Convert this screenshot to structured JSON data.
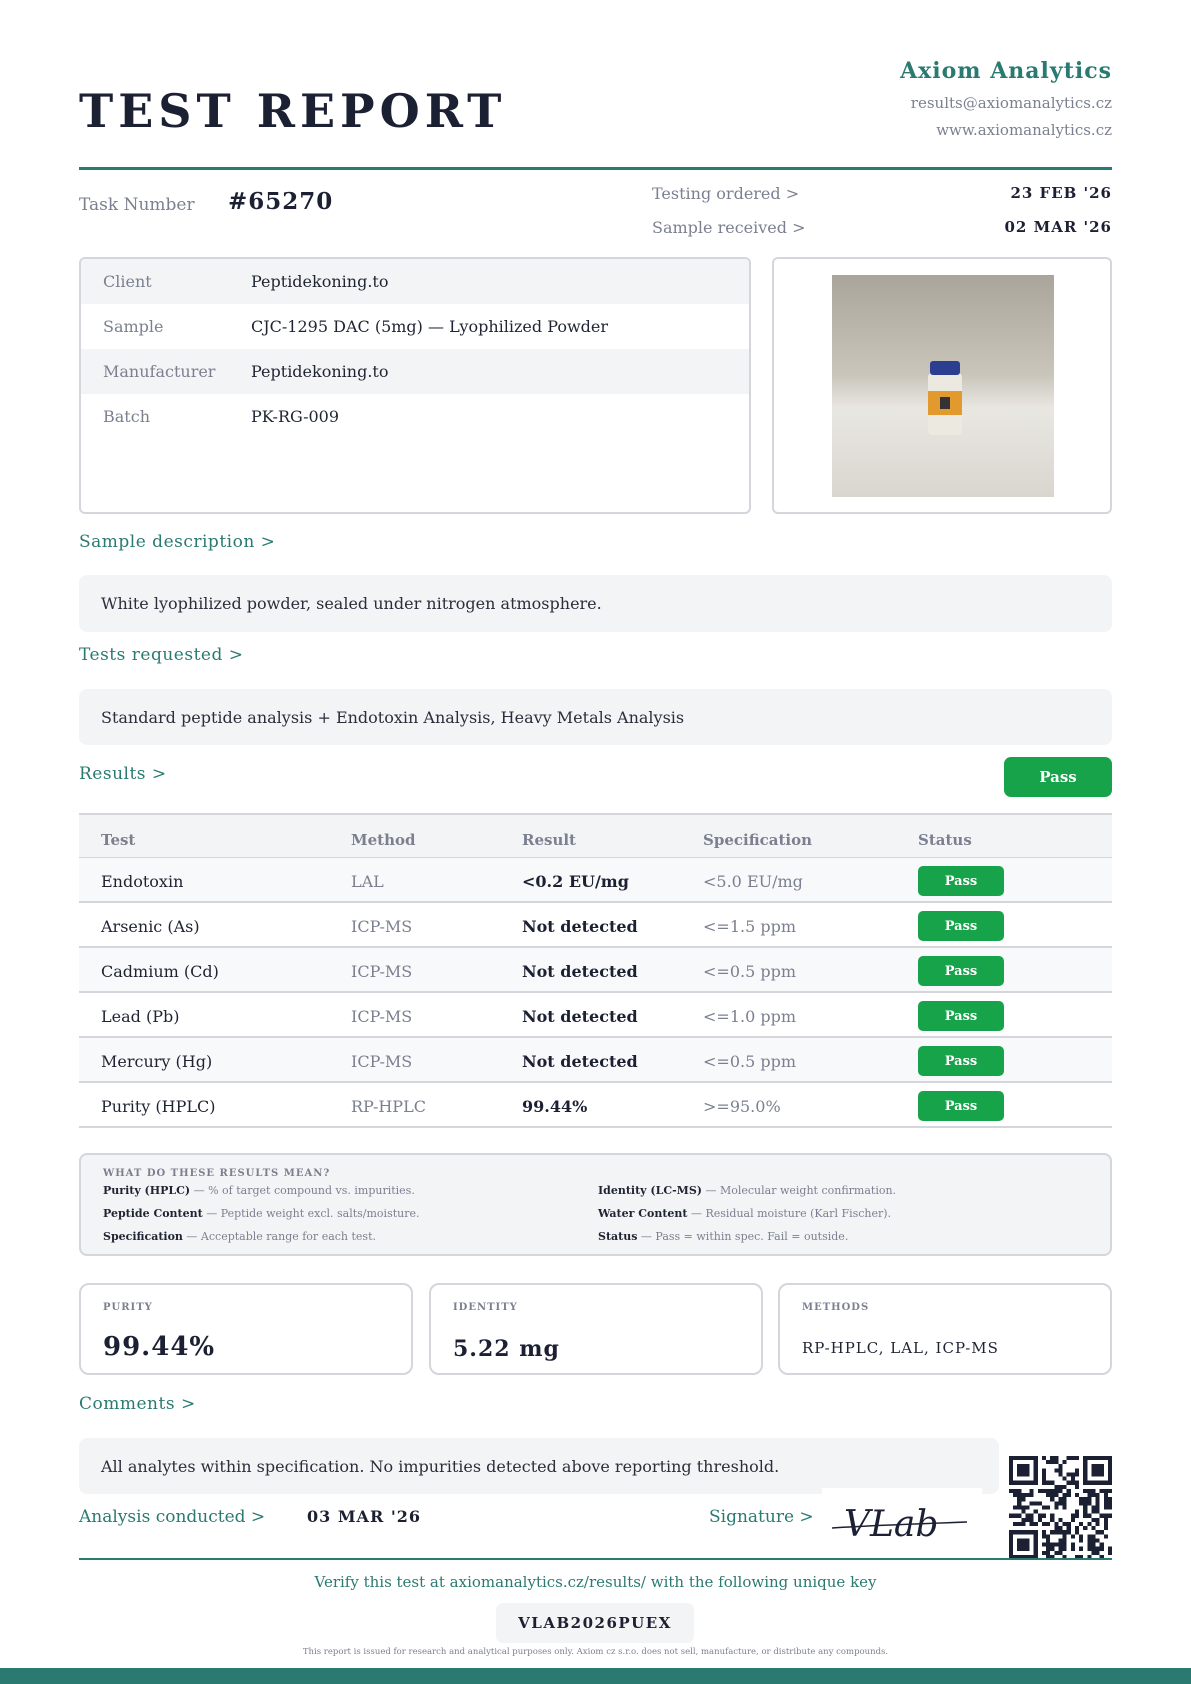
{
  "header": {
    "title": "TEST REPORT",
    "brand": "Axiom Analytics",
    "email": "results@axiomanalytics.cz",
    "website": "www.axiomanalytics.cz"
  },
  "meta": {
    "task_label": "Task Number",
    "task_number": "#65270",
    "ordered_label": "Testing ordered >",
    "ordered_value": "23 FEB '26",
    "received_label": "Sample received >",
    "received_value": "02 MAR '26"
  },
  "info": [
    {
      "label": "Client",
      "value": "Peptidekoning.to"
    },
    {
      "label": "Sample",
      "value": " CJC-1295 DAC (5mg) — Lyophilized Powder"
    },
    {
      "label": "Manufacturer",
      "value": "Peptidekoning.to"
    },
    {
      "label": "Batch",
      "value": "PK-RG-009"
    }
  ],
  "sample_description": {
    "heading": "Sample description >",
    "text": "White lyophilized powder, sealed under nitrogen atmosphere."
  },
  "tests_requested": {
    "heading": "Tests requested >",
    "text": "Standard peptide analysis + Endotoxin Analysis, Heavy Metals Analysis"
  },
  "results": {
    "heading": "Results >",
    "overall": "Pass",
    "columns": [
      "Test",
      "Method",
      "Result",
      "Specification",
      "Status"
    ],
    "rows": [
      {
        "test": "Endotoxin",
        "method": "LAL",
        "result": "<0.2 EU/mg",
        "spec": "<5.0 EU/mg",
        "status": "Pass"
      },
      {
        "test": "Arsenic (As)",
        "method": "ICP-MS",
        "result": "Not detected",
        "spec": "<=1.5 ppm",
        "status": "Pass"
      },
      {
        "test": "Cadmium (Cd)",
        "method": "ICP-MS",
        "result": "Not detected",
        "spec": "<=0.5 ppm",
        "status": "Pass"
      },
      {
        "test": "Lead (Pb)",
        "method": "ICP-MS",
        "result": "Not detected",
        "spec": "<=1.0 ppm",
        "status": "Pass"
      },
      {
        "test": "Mercury (Hg)",
        "method": "ICP-MS",
        "result": "Not detected",
        "spec": "<=0.5 ppm",
        "status": "Pass"
      },
      {
        "test": "Purity (HPLC)",
        "method": "RP-HPLC",
        "result": "99.44%",
        "spec": ">=95.0%",
        "status": "Pass"
      }
    ]
  },
  "legend": {
    "title": "WHAT DO THESE RESULTS MEAN?",
    "items": [
      {
        "term": "Purity (HPLC)",
        "desc": " — % of target compound vs. impurities."
      },
      {
        "term": "Identity (LC-MS)",
        "desc": " — Molecular weight confirmation."
      },
      {
        "term": "Peptide Content",
        "desc": " — Peptide weight excl. salts/moisture."
      },
      {
        "term": "Water Content",
        "desc": " — Residual moisture (Karl Fischer)."
      },
      {
        "term": "Specification",
        "desc": " — Acceptable range for each test."
      },
      {
        "term": "Status",
        "desc": " — Pass = within spec. Fail = outside."
      }
    ]
  },
  "stats": [
    {
      "label": "PURITY",
      "value": "99.44%"
    },
    {
      "label": "IDENTITY",
      "value": "5.22 mg"
    },
    {
      "label": "METHODS",
      "value": "RP-HPLC, LAL, ICP-MS"
    }
  ],
  "comments": {
    "heading": "Comments >",
    "text": "All analytes within specification. No impurities detected above reporting threshold."
  },
  "footer": {
    "analysis_label": "Analysis conducted >",
    "analysis_value": "03 MAR '26",
    "signature_label": "Signature >",
    "signature_text": "VLab",
    "verify_text": "Verify this test at axiomanalytics.cz/results/ with the following unique key",
    "unique_key": "VLAB2026PUEX",
    "disclaimer": "This report is issued for research and analytical purposes only. Axiom cz s.r.o. does not sell, manufacture, or distribute any compounds."
  },
  "colors": {
    "accent": "#2a7a72",
    "pass": "#16a34a",
    "ink": "#1c2033"
  }
}
